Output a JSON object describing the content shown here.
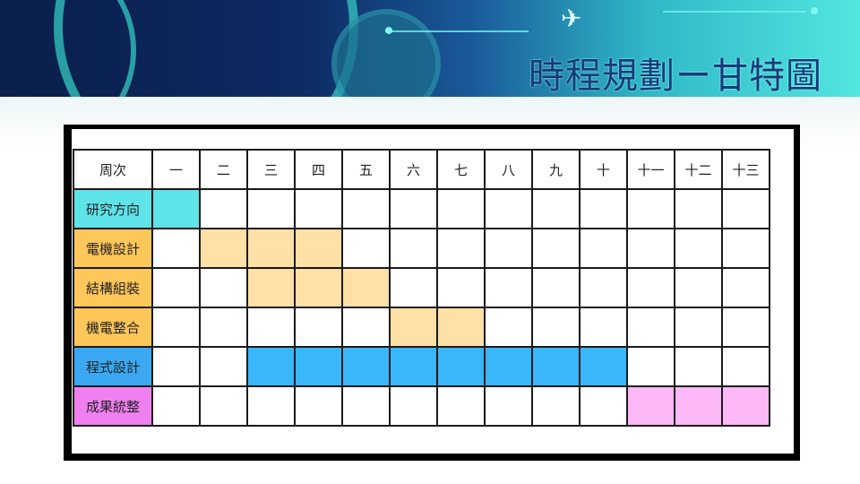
{
  "title": "時程規劃ー甘特圖",
  "header": {
    "label": "周次",
    "weeks": [
      "一",
      "二",
      "三",
      "四",
      "五",
      "六",
      "七",
      "八",
      "九",
      "十",
      "十一",
      "十二",
      "十三"
    ]
  },
  "rows": [
    {
      "label": "研究方向",
      "label_color": "#5ee3e8",
      "bar_color": "#5ee3e8",
      "weeks": [
        1
      ]
    },
    {
      "label": "電機設計",
      "label_color": "#ffc65a",
      "bar_color": "#ffe0a6",
      "weeks": [
        2,
        3,
        4
      ]
    },
    {
      "label": "結構組裝",
      "label_color": "#ffc65a",
      "bar_color": "#ffe0a6",
      "weeks": [
        3,
        4,
        5
      ]
    },
    {
      "label": "機電整合",
      "label_color": "#ffc65a",
      "bar_color": "#ffe0a6",
      "weeks": [
        6,
        7
      ]
    },
    {
      "label": "程式設計",
      "label_color": "#3aa8f2",
      "bar_color": "#3ab6fb",
      "weeks": [
        3,
        4,
        5,
        6,
        7,
        8,
        9,
        10
      ]
    },
    {
      "label": "成果統整",
      "label_color": "#f07ff0",
      "bar_color": "#fdb8f8",
      "weeks": [
        11,
        12,
        13
      ]
    }
  ]
}
